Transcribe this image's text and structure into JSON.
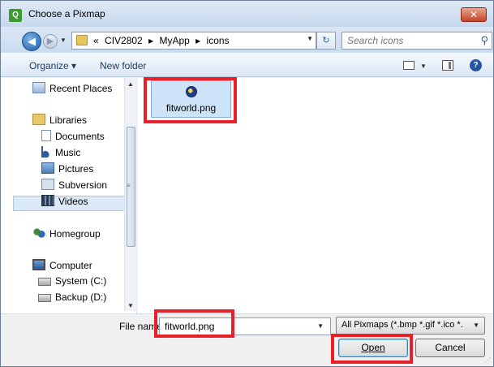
{
  "window": {
    "title": "Choose a Pixmap",
    "app_icon_text": "Q",
    "close_glyph": "✕"
  },
  "address": {
    "prefix": "«",
    "crumbs": [
      "CIV2802",
      "MyApp",
      "icons"
    ],
    "separator": "▸",
    "search_placeholder": "Search icons"
  },
  "toolbar": {
    "organize": "Organize ▾",
    "new_folder": "New folder"
  },
  "nav_pane": {
    "items": [
      {
        "label": "Recent Places",
        "icon": "recent-places-icon"
      },
      {
        "label": "Libraries",
        "icon": "libraries-icon"
      },
      {
        "label": "Documents",
        "icon": "documents-icon"
      },
      {
        "label": "Music",
        "icon": "music-icon"
      },
      {
        "label": "Pictures",
        "icon": "pictures-icon"
      },
      {
        "label": "Subversion",
        "icon": "subversion-icon"
      },
      {
        "label": "Videos",
        "icon": "videos-icon"
      },
      {
        "label": "Homegroup",
        "icon": "homegroup-icon"
      },
      {
        "label": "Computer",
        "icon": "computer-icon"
      },
      {
        "label": "System (C:)",
        "icon": "drive-icon"
      },
      {
        "label": "Backup (D:)",
        "icon": "drive-icon"
      }
    ],
    "selected": "System (C:)"
  },
  "files": [
    {
      "name": "fitworld.png",
      "icon": "globe-image-icon",
      "selected": true
    }
  ],
  "bottom": {
    "file_name_label": "File name:",
    "file_name_value": "fitworld.png",
    "filter": "All Pixmaps (*.bmp *.gif *.ico *.",
    "open_label": "Open",
    "cancel_label": "Cancel"
  },
  "colors": {
    "highlight": "#e8202a",
    "selection": "#cce3f8"
  }
}
